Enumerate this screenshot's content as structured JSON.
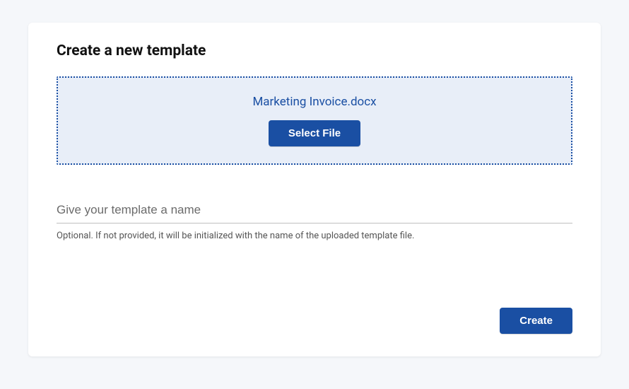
{
  "header": {
    "title": "Create a new template"
  },
  "dropzone": {
    "filename": "Marketing Invoice.docx",
    "select_file_label": "Select File"
  },
  "name_field": {
    "placeholder": "Give your template a name",
    "value": "",
    "helper": "Optional. If not provided, it will be initialized with the name of the uploaded template file."
  },
  "actions": {
    "create_label": "Create"
  },
  "colors": {
    "primary": "#1a4fa3",
    "dropzone_bg": "#e8eef8",
    "page_bg": "#f5f7fa"
  }
}
